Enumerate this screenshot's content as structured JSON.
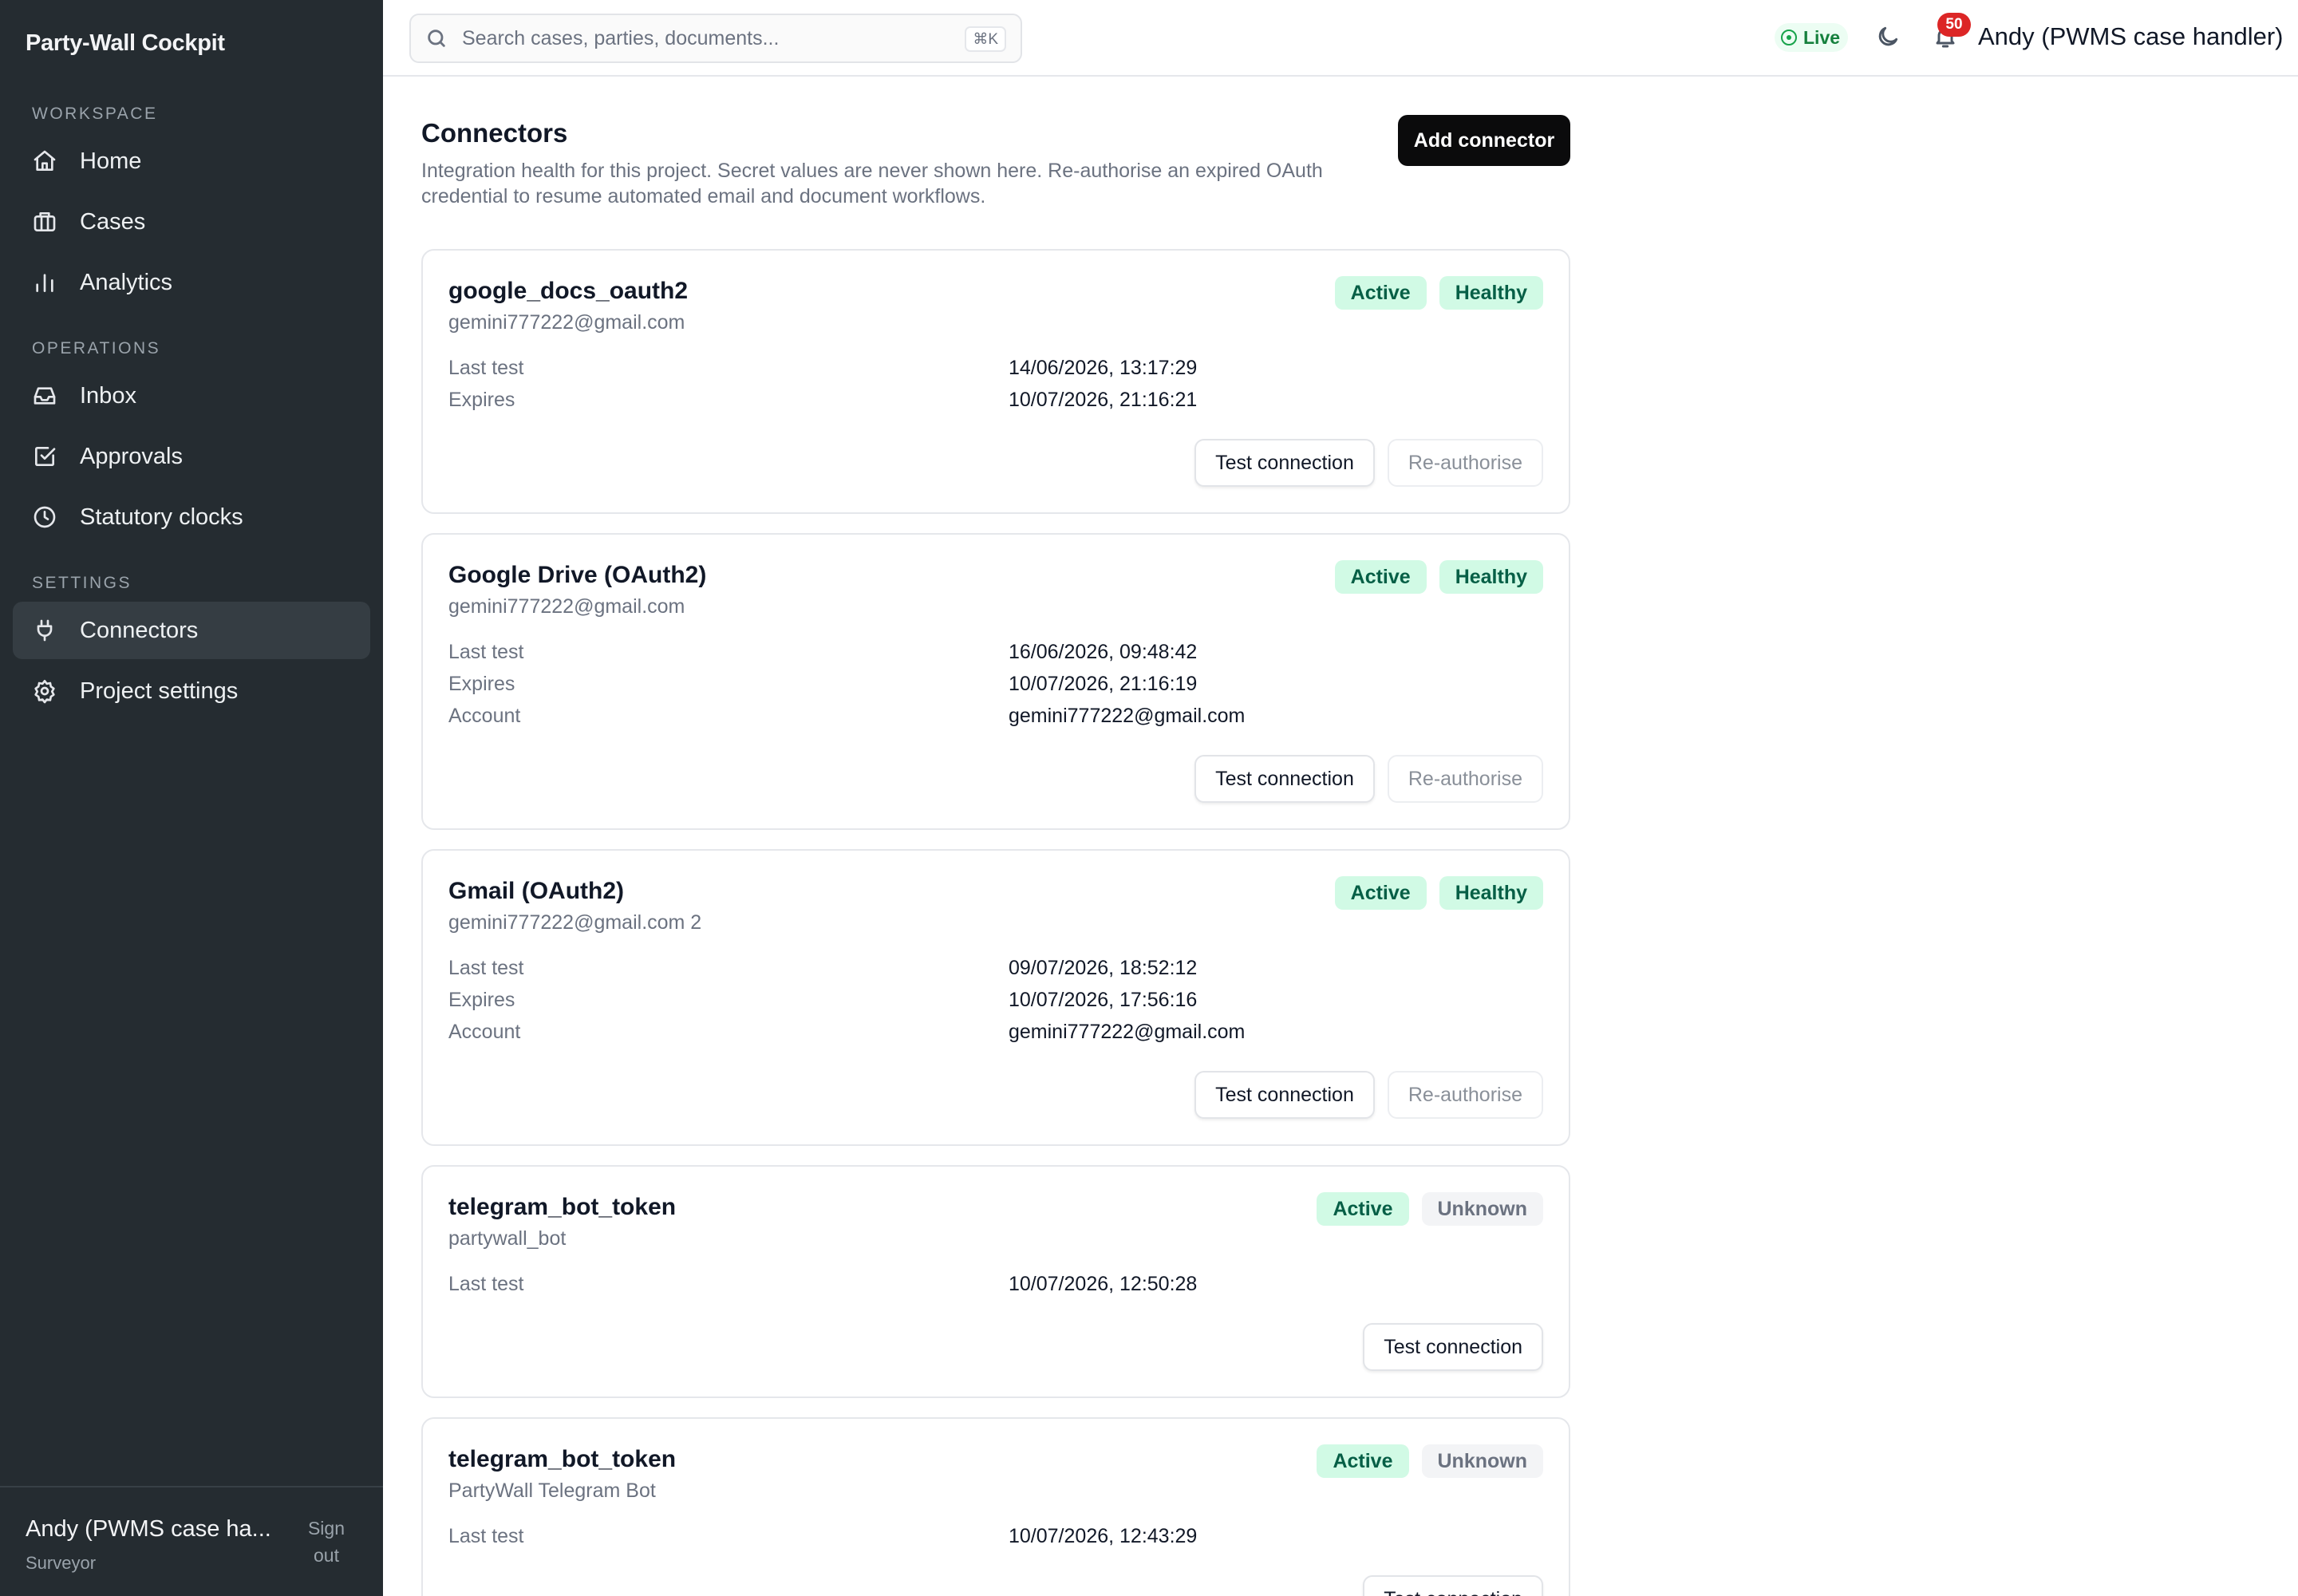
{
  "app": {
    "brand": "Party-Wall Cockpit"
  },
  "sidebar": {
    "sections": [
      {
        "title": "WORKSPACE",
        "items": [
          {
            "label": "Home",
            "icon": "home-icon"
          },
          {
            "label": "Cases",
            "icon": "briefcase-icon"
          },
          {
            "label": "Analytics",
            "icon": "bar-chart-icon"
          }
        ]
      },
      {
        "title": "OPERATIONS",
        "items": [
          {
            "label": "Inbox",
            "icon": "inbox-icon"
          },
          {
            "label": "Approvals",
            "icon": "check-square-icon"
          },
          {
            "label": "Statutory clocks",
            "icon": "clock-icon"
          }
        ]
      },
      {
        "title": "SETTINGS",
        "items": [
          {
            "label": "Connectors",
            "icon": "plug-icon",
            "active": true
          },
          {
            "label": "Project settings",
            "icon": "gear-icon"
          }
        ]
      }
    ],
    "footer": {
      "user": "Andy (PWMS case ha...",
      "role": "Surveyor",
      "signout": "Sign out"
    }
  },
  "topbar": {
    "search_placeholder": "Search cases, parties, documents...",
    "shortcut": "⌘K",
    "live_label": "Live",
    "notification_count": "50",
    "user": "Andy (PWMS case handler)"
  },
  "main": {
    "title": "Connectors",
    "description": "Integration health for this project. Secret values are never shown here. Re-authorise an expired OAuth credential to resume automated email and document workflows.",
    "add_button": "Add connector",
    "cards": [
      {
        "name": "google_docs_oauth2",
        "subtitle": "gemini777222@gmail.com",
        "status": "Active",
        "health": "Healthy",
        "rows": [
          {
            "label": "Last test",
            "value": "14/06/2026, 13:17:29"
          },
          {
            "label": "Expires",
            "value": "10/07/2026, 21:16:21"
          }
        ],
        "test_label": "Test connection",
        "reauth_label": "Re-authorise"
      },
      {
        "name": "Google Drive (OAuth2)",
        "subtitle": "gemini777222@gmail.com",
        "status": "Active",
        "health": "Healthy",
        "rows": [
          {
            "label": "Last test",
            "value": "16/06/2026, 09:48:42"
          },
          {
            "label": "Expires",
            "value": "10/07/2026, 21:16:19"
          },
          {
            "label": "Account",
            "value": "gemini777222@gmail.com"
          }
        ],
        "test_label": "Test connection",
        "reauth_label": "Re-authorise"
      },
      {
        "name": "Gmail (OAuth2)",
        "subtitle": "gemini777222@gmail.com 2",
        "status": "Active",
        "health": "Healthy",
        "rows": [
          {
            "label": "Last test",
            "value": "09/07/2026, 18:52:12"
          },
          {
            "label": "Expires",
            "value": "10/07/2026, 17:56:16"
          },
          {
            "label": "Account",
            "value": "gemini777222@gmail.com"
          }
        ],
        "test_label": "Test connection",
        "reauth_label": "Re-authorise"
      },
      {
        "name": "telegram_bot_token",
        "subtitle": "partywall_bot",
        "status": "Active",
        "health": "Unknown",
        "rows": [
          {
            "label": "Last test",
            "value": "10/07/2026, 12:50:28"
          }
        ],
        "test_label": "Test connection"
      },
      {
        "name": "telegram_bot_token",
        "subtitle": "PartyWall Telegram Bot",
        "status": "Active",
        "health": "Unknown",
        "rows": [
          {
            "label": "Last test",
            "value": "10/07/2026, 12:43:29"
          }
        ],
        "test_label": "Test connection"
      }
    ]
  },
  "colors": {
    "sidebar_bg": "#252c31",
    "active_item_bg": "#353d43",
    "pill_green_bg": "#d1fae5",
    "pill_green_text": "#065f46",
    "pill_gray_bg": "#f3f4f6",
    "badge_red": "#dc2626",
    "primary_button": "#0b0b0c"
  }
}
